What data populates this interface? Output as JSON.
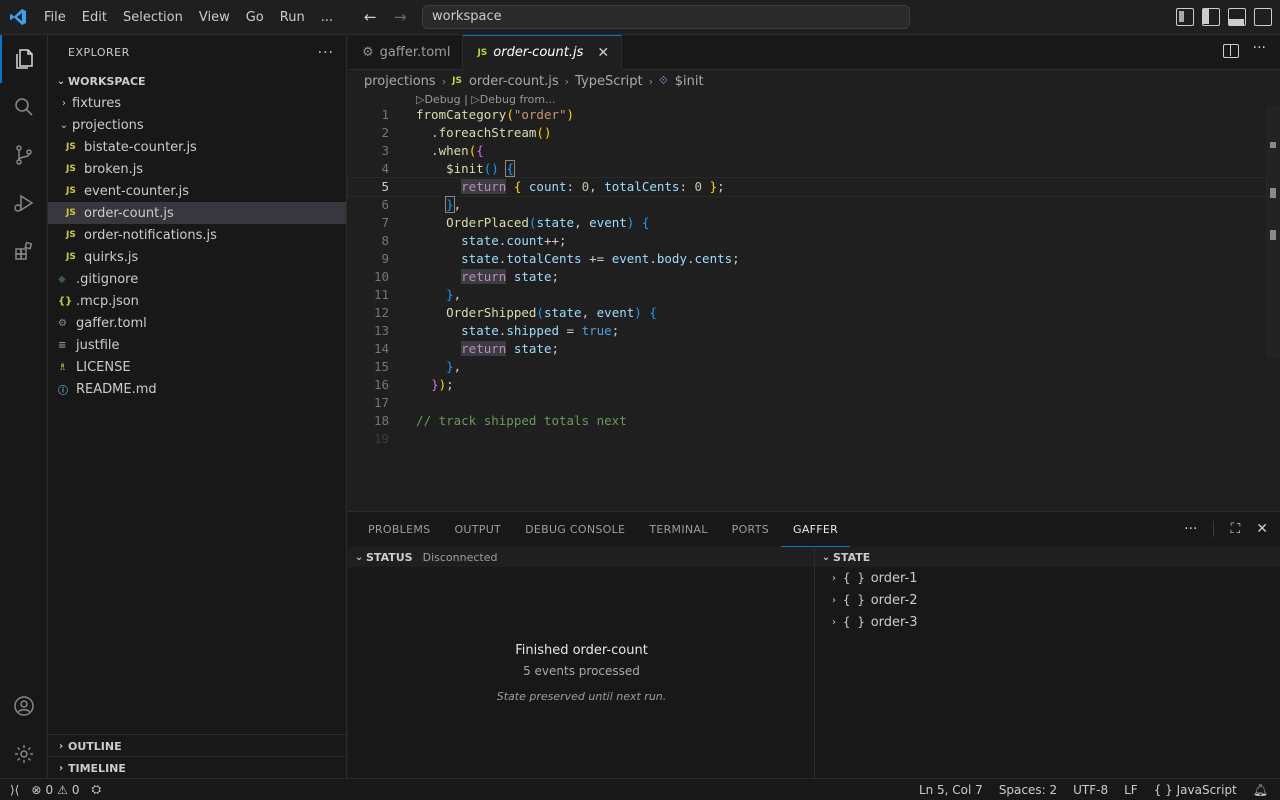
{
  "titlebar": {
    "menu": [
      "File",
      "Edit",
      "Selection",
      "View",
      "Go",
      "Run",
      "..."
    ],
    "search": "workspace"
  },
  "explorer": {
    "header": "EXPLORER",
    "workspace": "WORKSPACE",
    "items": [
      {
        "label": "fixtures",
        "kind": "folder",
        "indent": 1,
        "open": false
      },
      {
        "label": "projections",
        "kind": "folder",
        "indent": 1,
        "open": true
      },
      {
        "label": "bistate-counter.js",
        "kind": "js",
        "indent": 2
      },
      {
        "label": "broken.js",
        "kind": "js",
        "indent": 2
      },
      {
        "label": "event-counter.js",
        "kind": "js",
        "indent": 2
      },
      {
        "label": "order-count.js",
        "kind": "js",
        "indent": 2,
        "selected": true
      },
      {
        "label": "order-notifications.js",
        "kind": "js",
        "indent": 2
      },
      {
        "label": "quirks.js",
        "kind": "js",
        "indent": 2
      },
      {
        "label": ".gitignore",
        "kind": "git",
        "indent": 1
      },
      {
        "label": ".mcp.json",
        "kind": "json",
        "indent": 1
      },
      {
        "label": "gaffer.toml",
        "kind": "gear",
        "indent": 1
      },
      {
        "label": "justfile",
        "kind": "just",
        "indent": 1
      },
      {
        "label": "LICENSE",
        "kind": "lic",
        "indent": 1
      },
      {
        "label": "README.md",
        "kind": "info",
        "indent": 1
      }
    ],
    "outline": "OUTLINE",
    "timeline": "TIMELINE"
  },
  "editor": {
    "tabs": [
      {
        "label": "gaffer.toml",
        "icon": "gear-icon",
        "active": false
      },
      {
        "label": "order-count.js",
        "icon": "js-icon",
        "active": true
      }
    ],
    "breadcrumb": [
      "projections",
      "order-count.js",
      "TypeScript",
      "$init"
    ],
    "codelens": "▷Debug | ▷Debug from...",
    "current_line": 5,
    "lines": [
      "1",
      "2",
      "3",
      "4",
      "5",
      "6",
      "7",
      "8",
      "9",
      "10",
      "11",
      "12",
      "13",
      "14",
      "15",
      "16",
      "17",
      "18",
      "19"
    ]
  },
  "panel": {
    "tabs": [
      "PROBLEMS",
      "OUTPUT",
      "DEBUG CONSOLE",
      "TERMINAL",
      "PORTS",
      "GAFFER"
    ],
    "status_title": "STATUS",
    "status_desc": "Disconnected",
    "finished": "Finished order-count",
    "events": "5 events processed",
    "preserved": "State preserved until next run.",
    "state_title": "STATE",
    "states": [
      "order-1",
      "order-2",
      "order-3"
    ]
  },
  "statusbar": {
    "errors": "0",
    "warnings": "0",
    "position": "Ln 5, Col 7",
    "spaces": "Spaces: 2",
    "encoding": "UTF-8",
    "eol": "LF",
    "language": "JavaScript"
  },
  "colors": {
    "accent": "#0078d4",
    "background": "#1f1f1f",
    "sidebar": "#181818"
  }
}
